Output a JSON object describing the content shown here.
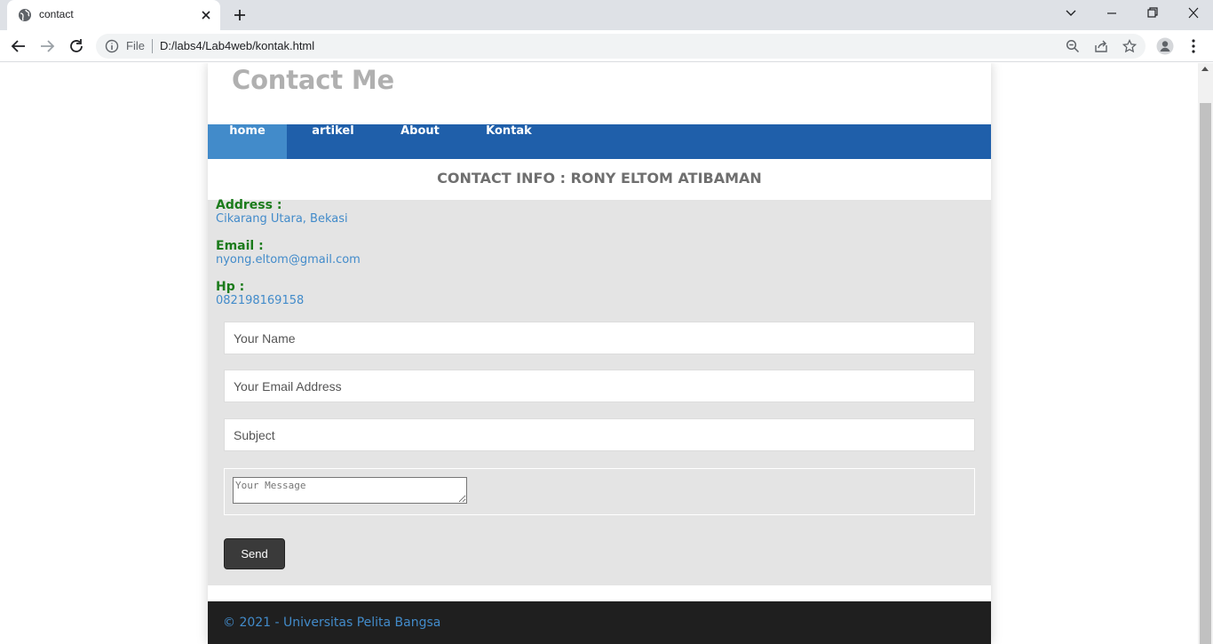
{
  "browser": {
    "tab_title": "contact",
    "url_scheme": "File",
    "url": "D:/labs4/Lab4web/kontak.html"
  },
  "site": {
    "title": "Contact Me",
    "nav": [
      {
        "label": "home",
        "active": true
      },
      {
        "label": "artikel",
        "active": false
      },
      {
        "label": "About",
        "active": false
      },
      {
        "label": "Kontak",
        "active": false
      }
    ]
  },
  "contact": {
    "heading": "CONTACT INFO : RONY ELTOM ATIBAMAN",
    "address_label": "Address :",
    "address_value": "Cikarang Utara, Bekasi",
    "email_label": "Email :",
    "email_value": "nyong.eltom@gmail.com",
    "hp_label": "Hp :",
    "hp_value": "082198169158"
  },
  "form": {
    "name_placeholder": "Your Name",
    "email_placeholder": "Your Email Address",
    "subject_placeholder": "Subject",
    "message_placeholder": "Your Message",
    "send_label": "Send"
  },
  "footer": {
    "text": "© 2021 - Universitas Pelita Bangsa"
  },
  "colors": {
    "nav_bg": "#1f5faa",
    "nav_active": "#428bca",
    "label_green": "#1b7b1b",
    "link_blue": "#428bca",
    "footer_bg": "#1f1f1f"
  }
}
